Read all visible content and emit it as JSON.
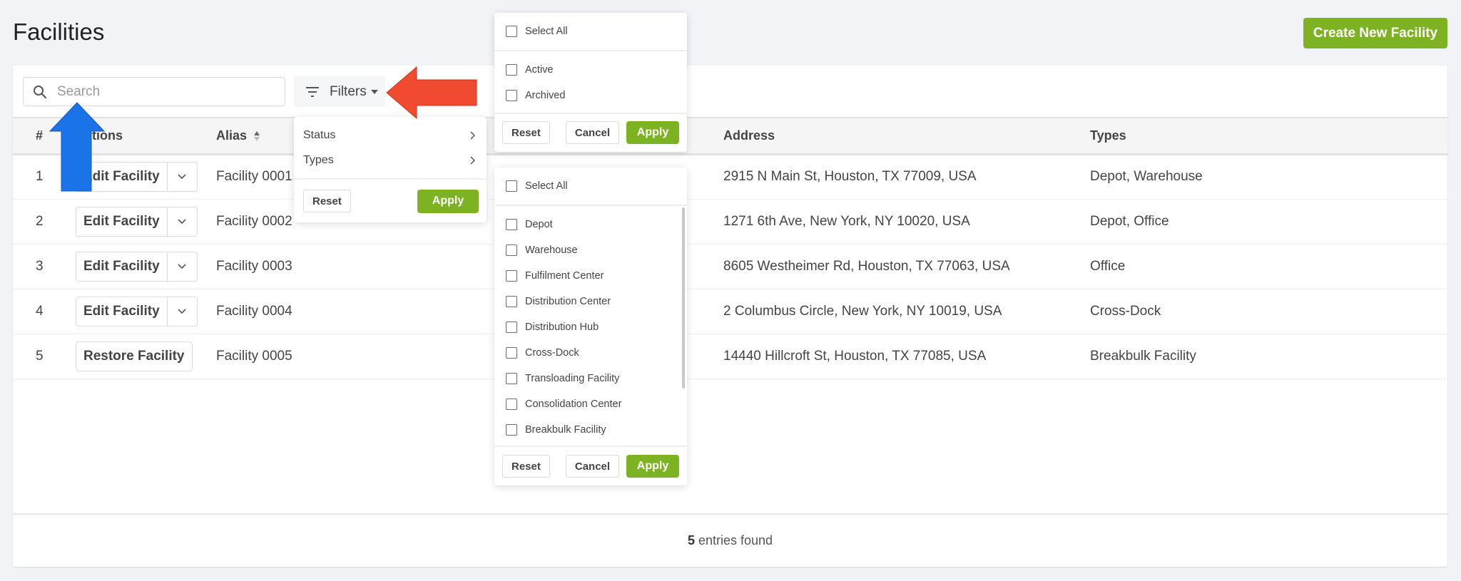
{
  "page": {
    "title": "Facilities",
    "create_button": "Create New Facility"
  },
  "toolbar": {
    "search_placeholder": "Search",
    "search_value": "",
    "filters_label": "Filters"
  },
  "table": {
    "columns": [
      "#",
      "Actions",
      "Alias",
      "Address",
      "Types"
    ],
    "rows": [
      {
        "num": "1",
        "action": "Edit Facility",
        "split": true,
        "alias": "Facility 0001",
        "address": "2915 N Main St, Houston, TX 77009, USA",
        "types": "Depot, Warehouse"
      },
      {
        "num": "2",
        "action": "Edit Facility",
        "split": true,
        "alias": "Facility 0002",
        "address": "1271 6th Ave, New York, NY 10020, USA",
        "types": "Depot, Office"
      },
      {
        "num": "3",
        "action": "Edit Facility",
        "split": true,
        "alias": "Facility 0003",
        "address": "8605 Westheimer Rd, Houston, TX 77063, USA",
        "types": "Office"
      },
      {
        "num": "4",
        "action": "Edit Facility",
        "split": true,
        "alias": "Facility 0004",
        "address": "2 Columbus Circle, New York, NY 10019, USA",
        "types": "Cross-Dock"
      },
      {
        "num": "5",
        "action": "Restore Facility",
        "split": false,
        "alias": "Facility 0005",
        "address": "14440 Hillcroft St, Houston, TX 77085, USA",
        "types": "Breakbulk Facility"
      }
    ]
  },
  "footer": {
    "count": "5",
    "label": "entries found"
  },
  "filter_menu": {
    "items": [
      "Status",
      "Types"
    ],
    "reset": "Reset",
    "apply": "Apply"
  },
  "status_popover": {
    "select_all": "Select All",
    "options": [
      "Active",
      "Archived"
    ],
    "reset": "Reset",
    "cancel": "Cancel",
    "apply": "Apply"
  },
  "types_popover": {
    "select_all": "Select All",
    "options": [
      "Depot",
      "Warehouse",
      "Fulfilment Center",
      "Distribution Center",
      "Distribution Hub",
      "Cross-Dock",
      "Transloading Facility",
      "Consolidation Center",
      "Breakbulk Facility"
    ],
    "reset": "Reset",
    "cancel": "Cancel",
    "apply": "Apply"
  },
  "colors": {
    "accent": "#7db322",
    "annotation_red": "#f04a31",
    "annotation_blue": "#1a73e8"
  }
}
